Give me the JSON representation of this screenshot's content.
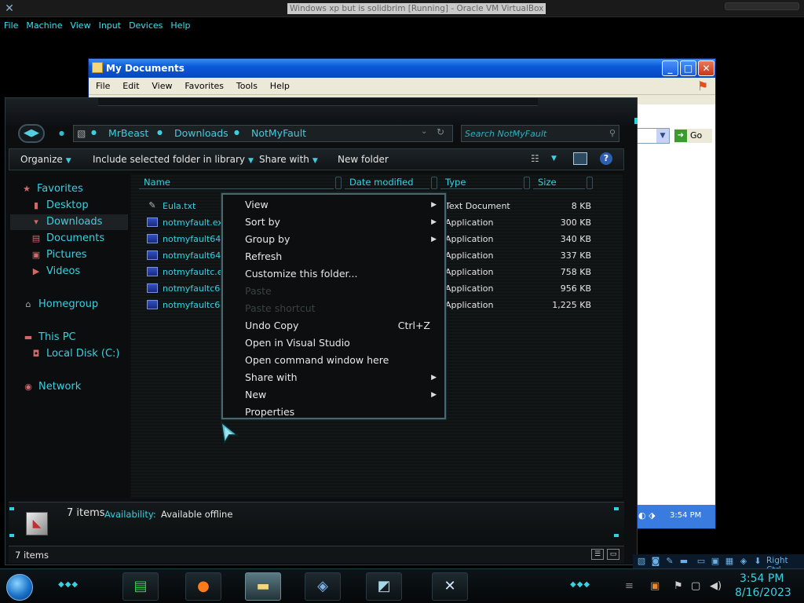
{
  "host": {
    "title": "Windows xp but is solidbrim [Running] - Oracle VM VirtualBox",
    "menu": [
      "File",
      "Machine",
      "View",
      "Input",
      "Devices",
      "Help"
    ]
  },
  "xp_window": {
    "title": "My Documents",
    "menu": [
      "File",
      "Edit",
      "View",
      "Favorites",
      "Tools",
      "Help"
    ],
    "go_label": "Go",
    "bottom_time": "3:54 PM"
  },
  "explorer": {
    "breadcrumb": [
      "MrBeast",
      "Downloads",
      "NotMyFault"
    ],
    "search_placeholder": "Search NotMyFault",
    "toolbar": {
      "organize": "Organize",
      "include": "Include selected folder in library",
      "share": "Share with",
      "new_folder": "New folder"
    },
    "nav": {
      "favorites": "Favorites",
      "desktop": "Desktop",
      "downloads": "Downloads",
      "documents": "Documents",
      "pictures": "Pictures",
      "videos": "Videos",
      "homegroup": "Homegroup",
      "this_pc": "This PC",
      "local_disk": "Local Disk (C:)",
      "network": "Network"
    },
    "columns": {
      "name": "Name",
      "date": "Date modified",
      "type": "Type",
      "size": "Size"
    },
    "files": [
      {
        "name": "Eula.txt",
        "type": "Text Document",
        "size": "8 KB"
      },
      {
        "name": "notmyfault.exe",
        "type": "Application",
        "size": "300 KB"
      },
      {
        "name": "notmyfault64.e",
        "type": "Application",
        "size": "340 KB"
      },
      {
        "name": "notmyfault64a.",
        "type": "Application",
        "size": "337 KB"
      },
      {
        "name": "notmyfaultc.exe",
        "type": "Application",
        "size": "758 KB"
      },
      {
        "name": "notmyfaultc64.",
        "type": "Application",
        "size": "956 KB"
      },
      {
        "name": "notmyfaultc64a",
        "type": "Application",
        "size": "1,225 KB"
      }
    ],
    "details": {
      "count": "7 items",
      "availability_label": "Availability:",
      "availability_value": "Available offline"
    },
    "status_count": "7 items"
  },
  "context_menu": {
    "items": [
      {
        "label": "View",
        "submenu": true
      },
      {
        "label": "Sort by",
        "submenu": true
      },
      {
        "label": "Group by",
        "submenu": true
      },
      {
        "label": "Refresh"
      },
      {
        "label": "Customize this folder..."
      },
      {
        "label": "Paste",
        "disabled": true
      },
      {
        "label": "Paste shortcut",
        "disabled": true
      },
      {
        "label": "Undo Copy",
        "shortcut": "Ctrl+Z"
      },
      {
        "label": "Open in Visual Studio"
      },
      {
        "label": "Open command window here"
      },
      {
        "label": "Share with",
        "submenu": true
      },
      {
        "label": "New",
        "submenu": true
      },
      {
        "label": "Properties"
      }
    ]
  },
  "taskbar": {
    "right_ctrl": "Right Ctrl",
    "clock_time": "3:54 PM",
    "clock_date": "8/16/2023"
  },
  "colors": {
    "accent": "#3ad0e0",
    "xp_blue": "#0a5ad8"
  }
}
